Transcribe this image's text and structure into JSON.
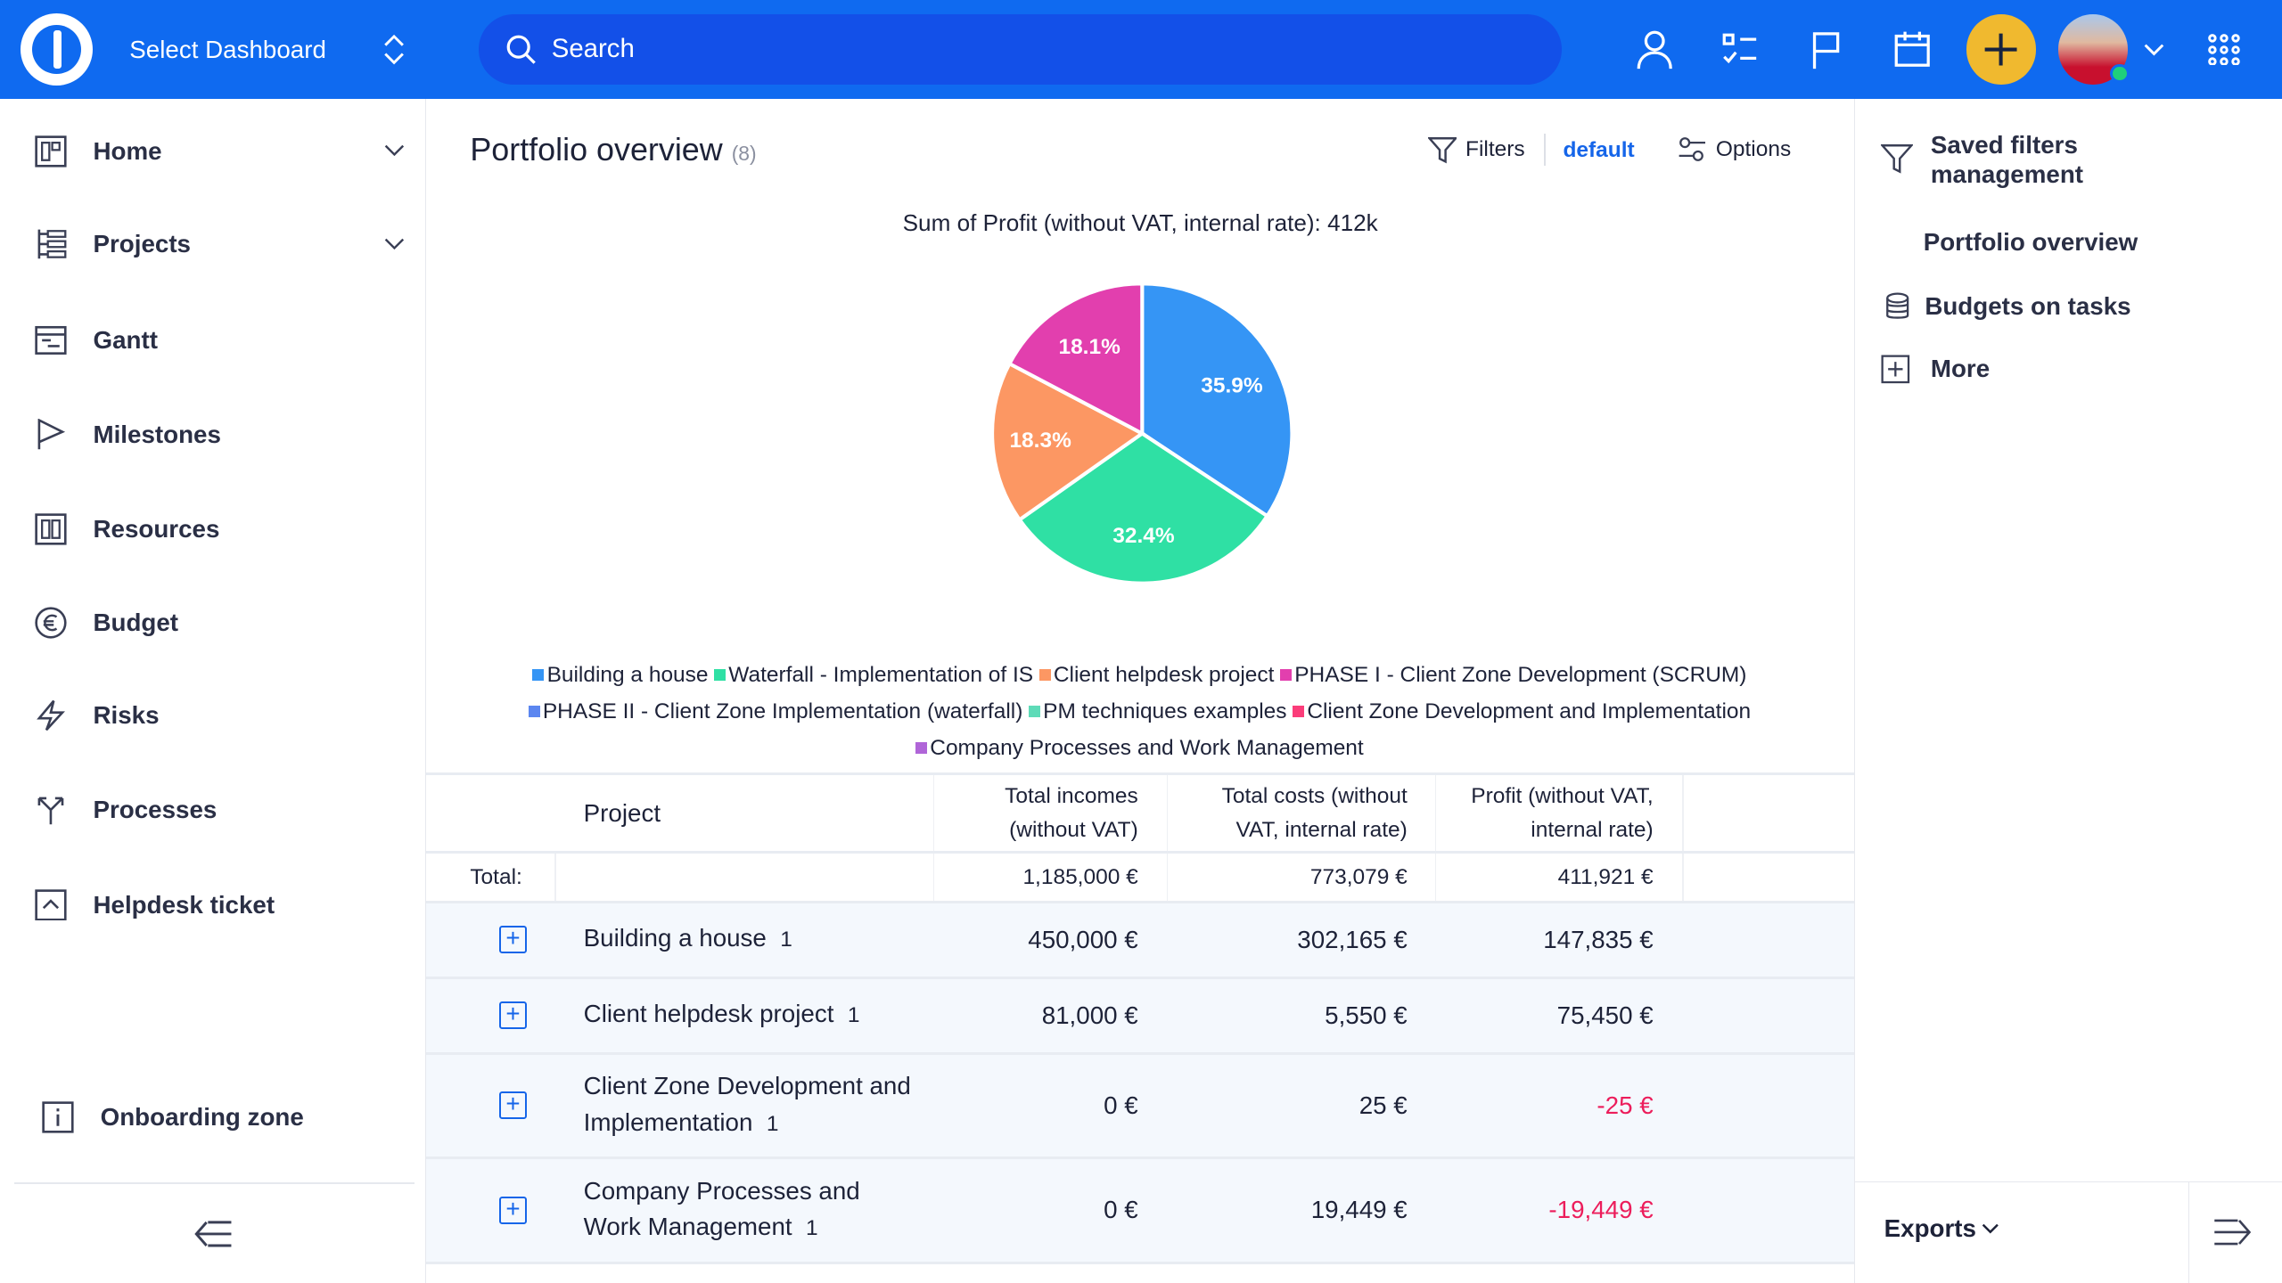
{
  "topbar": {
    "dashboard_label": "Select Dashboard",
    "search_placeholder": "Search",
    "brand_color": "#0f6af0",
    "add_color": "#f0b92f"
  },
  "sidebar": {
    "items": [
      {
        "label": "Home",
        "icon": "home-grid-icon",
        "expandable": true
      },
      {
        "label": "Projects",
        "icon": "projects-tree-icon",
        "expandable": true
      },
      {
        "label": "Gantt",
        "icon": "gantt-icon"
      },
      {
        "label": "Milestones",
        "icon": "flag-icon"
      },
      {
        "label": "Resources",
        "icon": "resources-icon"
      },
      {
        "label": "Budget",
        "icon": "euro-icon"
      },
      {
        "label": "Risks",
        "icon": "lightning-icon"
      },
      {
        "label": "Processes",
        "icon": "fork-icon"
      },
      {
        "label": "Helpdesk ticket",
        "icon": "ticket-icon"
      }
    ],
    "onboarding": "Onboarding zone"
  },
  "main": {
    "title": "Portfolio overview",
    "count": "(8)",
    "filters": "Filters",
    "filter_name": "default",
    "options": "Options"
  },
  "chart_data": {
    "type": "pie",
    "title": "Sum of Profit (without VAT, internal rate): 412k",
    "slices": [
      {
        "name": "Building a house",
        "value": 35.9,
        "label": "35.9%",
        "color": "#3595f5"
      },
      {
        "name": "Waterfall - Implementation of IS",
        "value": 32.4,
        "label": "32.4%",
        "color": "#2fe0a4"
      },
      {
        "name": "Client helpdesk project",
        "value": 18.3,
        "label": "18.3%",
        "color": "#fc9763"
      },
      {
        "name": "PHASE I - Client Zone Development (SCRUM)",
        "value": 18.1,
        "label": "18.1%",
        "color": "#e23fae"
      }
    ],
    "legend": [
      {
        "name": "Building a house",
        "color": "#3595f5"
      },
      {
        "name": "Waterfall - Implementation of IS",
        "color": "#2fe0a4"
      },
      {
        "name": "Client helpdesk project",
        "color": "#fc9763"
      },
      {
        "name": "PHASE I - Client Zone Development (SCRUM)",
        "color": "#e23fae"
      },
      {
        "name": "PHASE II - Client Zone Implementation (waterfall)",
        "color": "#5b86f0"
      },
      {
        "name": "PM techniques examples",
        "color": "#5edbb8"
      },
      {
        "name": "Client Zone Development and Implementation",
        "color": "#fb3d7a"
      },
      {
        "name": "Company Processes and Work Management",
        "color": "#b065d8"
      }
    ]
  },
  "table": {
    "headers": {
      "project": "Project",
      "incomes": "Total incomes (without VAT)",
      "costs": "Total costs (without VAT, internal rate)",
      "profit": "Profit (without VAT, internal rate)"
    },
    "total": {
      "label": "Total:",
      "incomes": "1,185,000 €",
      "costs": "773,079 €",
      "profit": "411,921 €"
    },
    "rows": [
      {
        "project": "Building a house",
        "count": "1",
        "incomes": "450,000 €",
        "costs": "302,165 €",
        "profit": "147,835 €"
      },
      {
        "project": "Client helpdesk project",
        "count": "1",
        "incomes": "81,000 €",
        "costs": "5,550 €",
        "profit": "75,450 €"
      },
      {
        "project": "Client Zone Development and Implementation",
        "count": "1",
        "incomes": "0 €",
        "costs": "25 €",
        "profit": "-25 €"
      },
      {
        "project": "Company Processes and Work Management",
        "count": "1",
        "incomes": "0 €",
        "costs": "19,449 €",
        "profit": "-19,449 €"
      }
    ]
  },
  "right_panel": {
    "saved_filters": "Saved filters management",
    "items": [
      "Portfolio overview",
      "Budgets on tasks"
    ],
    "more": "More",
    "exports": "Exports"
  }
}
